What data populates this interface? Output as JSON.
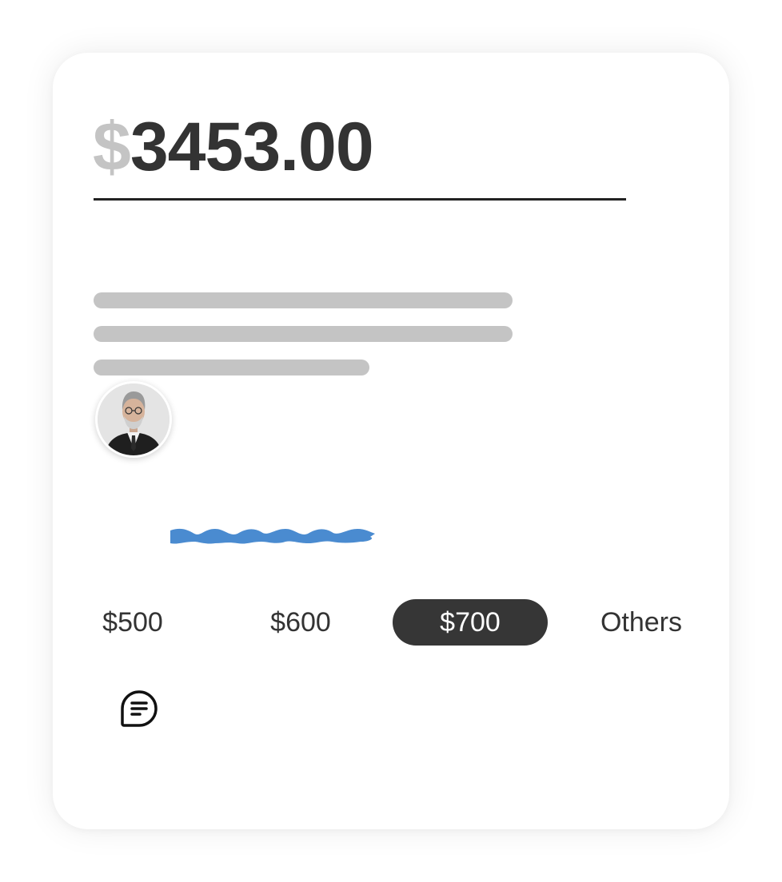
{
  "donation": {
    "currency_symbol": "$",
    "amount": "3453.00"
  },
  "options": [
    {
      "label": "$500",
      "selected": false
    },
    {
      "label": "$600",
      "selected": false
    },
    {
      "label": "$700",
      "selected": true
    },
    {
      "label": "Others",
      "selected": false
    }
  ],
  "colors": {
    "amount_text": "#333333",
    "currency_symbol": "#c4c4c4",
    "skeleton": "#c4c4c4",
    "selected_option_bg": "#363636",
    "signature": "#4a8bd0"
  },
  "icons": {
    "avatar": "user-avatar",
    "signature": "signature-scribble",
    "comment": "comment-icon"
  }
}
